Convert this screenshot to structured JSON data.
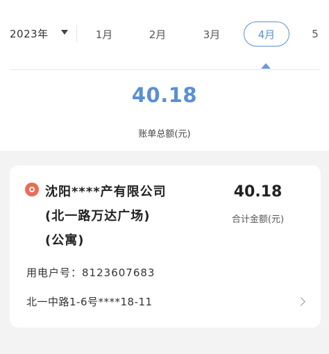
{
  "header": {
    "year_label": "2023年",
    "months": [
      "1月",
      "2月",
      "3月",
      "4月",
      "5"
    ],
    "active_month_index": 3
  },
  "summary": {
    "total_amount": "40.18",
    "total_label": "账单总额(元)"
  },
  "bill_card": {
    "company_name_lines": [
      "沈阳****产有限公司",
      "(北一路万达广场)",
      "(公寓)"
    ],
    "amount": "40.18",
    "amount_label": "合计金额(元)",
    "account_label": "用电户号：",
    "account_number": "8123607683",
    "address": "北一中路1-6号****18-11"
  },
  "colors": {
    "accent": "#5b8fd4",
    "company_icon": "#e96d58",
    "page_bg": "#f3f3f3"
  },
  "icons": {
    "year_dropdown": "caret-down-icon",
    "company": "company-icon",
    "detail": "chevron-right-icon"
  }
}
